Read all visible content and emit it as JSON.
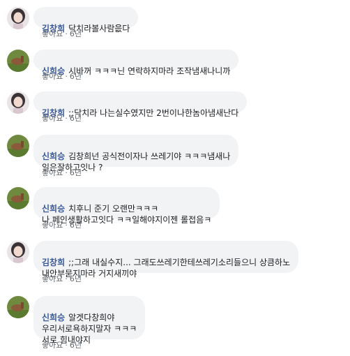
{
  "comments": [
    {
      "avatar": "girl-avatar",
      "author": "김창희",
      "text": "닥치라볼사람읎다",
      "like_label": "좋아요",
      "separator": "·",
      "time": "6년"
    },
    {
      "avatar": "horse-avatar",
      "author": "신희승",
      "text": "시바꺼 ㅋㅋㅋ닌 연락하지마라 조작냄새나니까",
      "like_label": "좋아요",
      "separator": "·",
      "time": "6년"
    },
    {
      "avatar": "girl-avatar",
      "author": "김창희",
      "text": ";;닥치라 나는실수였지만 2번이나한놈아냄새난다",
      "like_label": "좋아요",
      "separator": "·",
      "time": "6년"
    },
    {
      "avatar": "horse-avatar",
      "author": "신희승",
      "text": "김창희넌 공식전이자나 쓰레기야 ㅋㅋㅋ냄새나\n일은잘하고잇나 ?",
      "like_label": "좋아요",
      "separator": "·",
      "time": "6년"
    },
    {
      "avatar": "horse-avatar",
      "author": "신희승",
      "text": "치후니 준기 오랜만ㅋㅋㅋ\n나 페인생활하고잇다 ㅋㅋ일해야지이젠 롤접음ㅋ",
      "like_label": "좋아요",
      "separator": "·",
      "time": "6년"
    },
    {
      "avatar": "girl-avatar",
      "author": "김창희",
      "text": ";;그래 내실수지... 그래도쓰레기한테쓰레기소리들으니 상큼하노\n내안부묻지마라 거지새끼야",
      "like_label": "좋아요",
      "separator": "·",
      "time": "6년"
    },
    {
      "avatar": "horse-avatar",
      "author": "신희승",
      "text": "알겟다창희야\n우리서로욕하지말자 ㅋㅋㅋ\n서로 힘내야지",
      "like_label": "좋아요",
      "separator": "·",
      "time": "6년"
    }
  ]
}
